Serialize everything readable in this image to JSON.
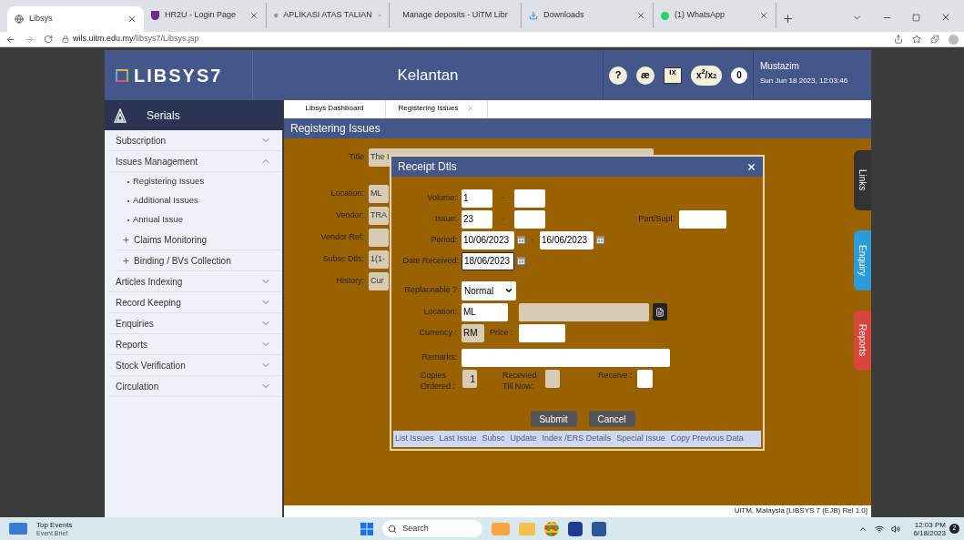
{
  "browser": {
    "tabs": [
      {
        "title": "Libsys",
        "selected": true
      },
      {
        "title": "HR2U - Login Page",
        "selected": false
      },
      {
        "title": "APLIKASI ATAS TALIAN",
        "selected": false
      },
      {
        "title": "Manage deposits - UiTM Libr",
        "selected": false
      },
      {
        "title": "Downloads",
        "selected": false
      },
      {
        "title": "(1) WhatsApp",
        "selected": false
      }
    ],
    "url_host": "wils.uitm.edu.my",
    "url_path": "/libsys7/Libsys.jsp"
  },
  "header": {
    "logo": "LIBSYS7",
    "branch": "Kelantan",
    "tools": [
      "?",
      "æ",
      "IX",
      "x$^{2}$/x$_{2}$"
    ],
    "counter": "0",
    "user": "Mustazim",
    "datetime": "Sun Jun 18 2023, 12:03:46"
  },
  "sidebar": {
    "title": "Serials",
    "items": [
      {
        "label": "Subscription",
        "expanded": false
      },
      {
        "label": "Issues Management",
        "expanded": true,
        "children": [
          {
            "label": "Registering Issues",
            "kind": "page"
          },
          {
            "label": "Additional Issues",
            "kind": "page"
          },
          {
            "label": "Annual Issue",
            "kind": "page"
          },
          {
            "label": "Claims Monitoring",
            "kind": "group"
          },
          {
            "label": "Binding / BVs Collection",
            "kind": "group"
          }
        ]
      },
      {
        "label": "Articles Indexing",
        "expanded": false
      },
      {
        "label": "Record Keeping",
        "expanded": false
      },
      {
        "label": "Enquiries",
        "expanded": false
      },
      {
        "label": "Reports",
        "expanded": false
      },
      {
        "label": "Stock Verification",
        "expanded": false
      },
      {
        "label": "Circulation",
        "expanded": false
      }
    ]
  },
  "tabs": [
    {
      "label": "Libsys Dashboard",
      "closable": false
    },
    {
      "label": "Registering Issues",
      "closable": true
    }
  ],
  "page_title": "Registering Issues",
  "form": [
    {
      "label": "Title",
      "value": "The I"
    },
    {
      "label": "Location:",
      "value": "ML"
    },
    {
      "label": "Vendor:",
      "value": "TRA"
    },
    {
      "label": "Vendor Ref:"
    },
    {
      "label": "Subsc Dtls:",
      "value": "1(1-"
    },
    {
      "label": "History:",
      "value": "Cur"
    }
  ],
  "dialog": {
    "title": "Receipt Dtls",
    "volume_label": "Volume:",
    "volume_from": "1",
    "volume_sep": "-",
    "issue_label": "Issue:",
    "issue_from": "23",
    "issue_sep": "-",
    "part_label": "Part/Supl:",
    "period_label": "Period:",
    "period_from": "10/06/2023",
    "period_sep": "-",
    "period_to": "16/06/2023",
    "received_label": "Date Received:",
    "received": "18/06/2023",
    "received_focused": true,
    "replaceable_label": "Replaceable ?",
    "replaceable": "Normal",
    "location_label": "Location:",
    "location": "ML",
    "currency_label": "Currency :",
    "currency": "RM",
    "price_label": "Price :",
    "remarks_label": "Remarks:",
    "copies_label": "Copies Ordered :",
    "copies": "1",
    "received_till_label": "Recevied Till Now:",
    "receive_label": "Receive :",
    "buttons": [
      "Submit",
      "Cancel"
    ],
    "links": [
      "List Issues",
      "Last Issue",
      "Subsc",
      "Update",
      "Index /ERS Details",
      "Special Issue",
      "Copy Previous Data"
    ]
  },
  "side_tabs": [
    {
      "label": "Links",
      "color": "#333333"
    },
    {
      "label": "Enquiry",
      "color": "#2b9cd8"
    },
    {
      "label": "Reports",
      "color": "#d8453d"
    }
  ],
  "footer": "UiTM, Malaysia [LIBSYS 7 (EJB) Rel 1.0]",
  "taskbar": {
    "widget_title": "Top Events",
    "widget_sub": "Event Brief",
    "search": "Search",
    "time": "12:03 PM",
    "date": "6/18/2023",
    "badge": "2"
  }
}
